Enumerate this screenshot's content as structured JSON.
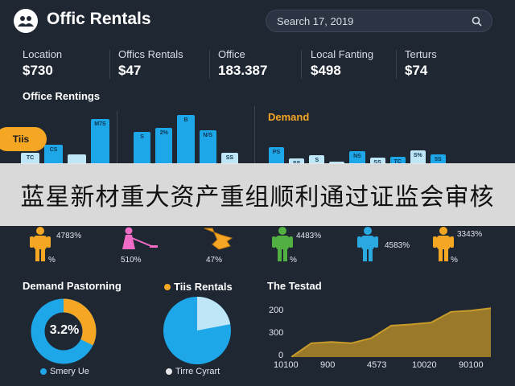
{
  "header": {
    "title": "Offic Rentals",
    "search_value": "Search 17, 2019"
  },
  "stats": [
    {
      "label": "Location",
      "value": "$730"
    },
    {
      "label": "Offics Rentals",
      "value": "$47"
    },
    {
      "label": "Office",
      "value": "183.387"
    },
    {
      "label": "Local Fanting",
      "value": "$498"
    },
    {
      "label": "Terturs",
      "value": "$74"
    }
  ],
  "office_rentings": {
    "title": "Office Rentings",
    "pill_label": "Tiis"
  },
  "demand": {
    "title": "Demand"
  },
  "banner": {
    "text": "蓝星新材重大资产重组顺利通过证监会审核"
  },
  "people": [
    {
      "label_top": "4783%",
      "label_bottom": "%"
    },
    {
      "label_top": "",
      "label_bottom": "510%"
    },
    {
      "label_top": "",
      "label_bottom": "47%"
    },
    {
      "label_top": "4483%",
      "label_bottom": "%"
    },
    {
      "label_top": "4583%",
      "label_bottom": ""
    },
    {
      "label_top": "3343%",
      "label_bottom": "%"
    }
  ],
  "donut_panel": {
    "title": "Demand Pastorning",
    "center_value": "3.2%",
    "legend": "Smery Ue",
    "percent": 32
  },
  "pie_panel": {
    "title": "Tiis Rentals",
    "legend": "Tirre Cyrart",
    "light_percent": 22
  },
  "area_panel": {
    "title": "The Testad",
    "y_ticks": [
      "200",
      "300",
      "0"
    ],
    "x_ticks": [
      "10100",
      "900",
      "4573",
      "10020",
      "90100"
    ]
  },
  "colors": {
    "background": "#1f2733",
    "bar_blue": "#1ea7e8",
    "bar_light": "#bfe6f7",
    "accent_orange": "#f5a623",
    "area_fill": "#9a7a2a",
    "area_line": "#c89b2a"
  },
  "bar_groups": {
    "office_rentings": [
      {
        "bars": [
          {
            "h": 0.22,
            "light": true,
            "lbl": "TC"
          },
          {
            "h": 0.38,
            "light": false,
            "lbl": "CS"
          },
          {
            "h": 0.18,
            "light": true,
            "lbl": ""
          },
          {
            "h": 0.88,
            "light": false,
            "lbl": "M7S"
          }
        ]
      },
      {
        "bars": [
          {
            "h": 0.62,
            "light": false,
            "lbl": "S"
          },
          {
            "h": 0.7,
            "light": false,
            "lbl": "2%"
          },
          {
            "h": 0.95,
            "light": false,
            "lbl": "B"
          },
          {
            "h": 0.65,
            "light": false,
            "lbl": "N/S"
          },
          {
            "h": 0.22,
            "light": true,
            "lbl": "SS"
          }
        ]
      }
    ],
    "demand": [
      {
        "h": 0.55,
        "light": false,
        "lbl": "PS"
      },
      {
        "h": 0.18,
        "light": true,
        "lbl": "SS"
      },
      {
        "h": 0.3,
        "light": true,
        "lbl": "S"
      },
      {
        "h": 0.08,
        "light": true,
        "lbl": ""
      },
      {
        "h": 0.42,
        "light": false,
        "lbl": "NS"
      },
      {
        "h": 0.22,
        "light": true,
        "lbl": "SS"
      },
      {
        "h": 0.25,
        "light": false,
        "lbl": "TC"
      },
      {
        "h": 0.45,
        "light": true,
        "lbl": "S%"
      },
      {
        "h": 0.32,
        "light": false,
        "lbl": "5S"
      }
    ]
  },
  "area_series": [
    0.0,
    0.22,
    0.24,
    0.22,
    0.3,
    0.5,
    0.52,
    0.55,
    0.72,
    0.74,
    0.78
  ]
}
